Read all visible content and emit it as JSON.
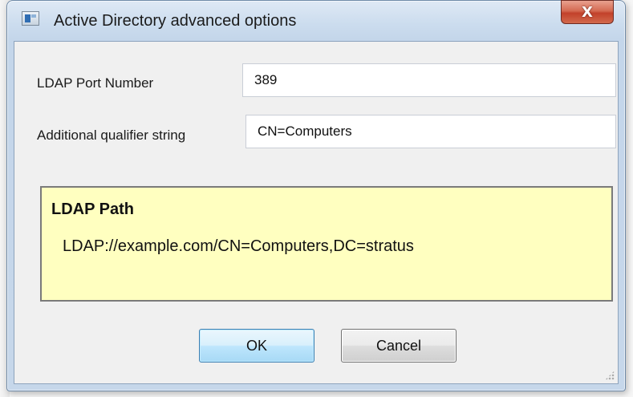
{
  "window": {
    "title": "Active Directory advanced options",
    "close_glyph": "X",
    "icon": "application-icon"
  },
  "form": {
    "port_label": "LDAP Port Number",
    "port_value": "389",
    "qualifier_label": "Additional qualifier string",
    "qualifier_value": "CN=Computers"
  },
  "ldap_path": {
    "heading": "LDAP Path",
    "value": "LDAP://example.com/CN=Computers,DC=stratus"
  },
  "buttons": {
    "ok_label": "OK",
    "cancel_label": "Cancel"
  },
  "colors": {
    "panel_background": "#ffffc0",
    "close_button": "#c2412a",
    "default_button": "#bee6fd"
  }
}
